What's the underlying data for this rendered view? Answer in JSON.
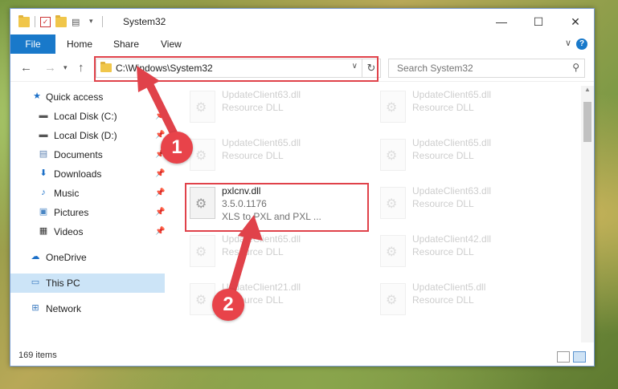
{
  "window": {
    "title": "System32"
  },
  "ribbon": {
    "tabs": [
      {
        "label": "File"
      },
      {
        "label": "Home"
      },
      {
        "label": "Share"
      },
      {
        "label": "View"
      }
    ],
    "help": "?"
  },
  "address": {
    "path": "C:\\Windows\\System32"
  },
  "search": {
    "placeholder": "Search System32"
  },
  "sidebar": {
    "items": [
      {
        "label": "Quick access"
      },
      {
        "label": "Local Disk (C:)"
      },
      {
        "label": "Local Disk (D:)"
      },
      {
        "label": "Documents"
      },
      {
        "label": "Downloads"
      },
      {
        "label": "Music"
      },
      {
        "label": "Pictures"
      },
      {
        "label": "Videos"
      },
      {
        "label": "OneDrive"
      },
      {
        "label": "This PC"
      },
      {
        "label": "Network"
      }
    ]
  },
  "files": [
    {
      "name": "UpdateClient63.dll",
      "type": "Resource DLL"
    },
    {
      "name": "UpdateClient65.dll",
      "type": "Resource DLL"
    },
    {
      "name": "UpdateClient65.dll",
      "type": "Resource DLL"
    },
    {
      "name": "UpdateClient65.dll",
      "type": "Resource DLL"
    },
    {
      "name": "UpdateClient63.dll",
      "type": "Resource DLL"
    },
    {
      "name": "UpdateClient65.dll",
      "type": "Resource DLL"
    },
    {
      "name": "UpdateClient42.dll",
      "type": "Resource DLL"
    },
    {
      "name": "UpdateClient21.dll",
      "type": "Resource DLL"
    },
    {
      "name": "UpdateClient5.dll",
      "type": "Resource DLL"
    }
  ],
  "highlighted_file": {
    "name": "pxlcnv.dll",
    "version": "3.5.0.1176",
    "description": "XLS to PXL and PXL ..."
  },
  "status": {
    "items_count": "169 items"
  },
  "annotations": {
    "badge1": "1",
    "badge2": "2",
    "color": "#e0424a"
  }
}
